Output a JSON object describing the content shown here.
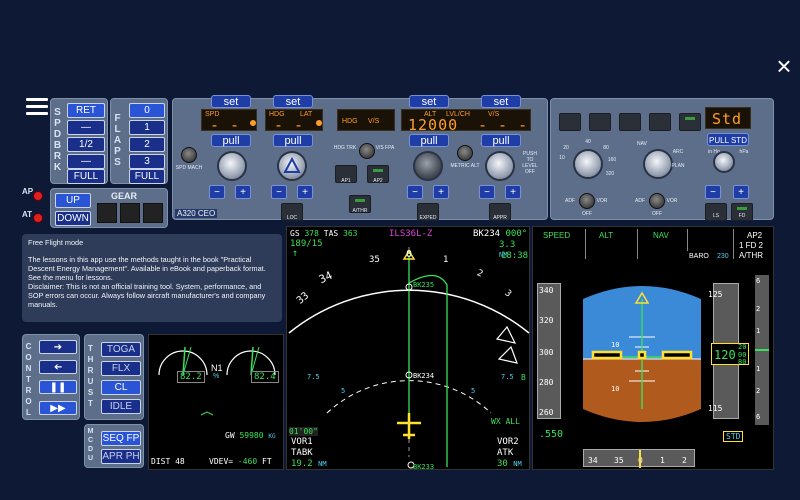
{
  "close_label": "×",
  "speedbrake": {
    "label": "SPD BRK",
    "buttons": [
      "RET",
      "—",
      "1/2",
      "—",
      "FULL"
    ]
  },
  "flaps": {
    "label": "FLAPS",
    "buttons": [
      "0",
      "1",
      "2",
      "3",
      "FULL"
    ]
  },
  "apat": {
    "ap": "AP",
    "at": "AT"
  },
  "gear": {
    "label": "GEAR",
    "up": "UP",
    "down": "DOWN"
  },
  "fcu": {
    "set": "set",
    "pull": "pull",
    "plus": "+",
    "minus": "−",
    "spd": "SPD",
    "mach_lbl": "MACH",
    "spd_mach": "SPD MACH",
    "hdg": "HDG",
    "lat": "LAT",
    "hdg_vs": "HDG",
    "vs": "V/S",
    "alt": "ALT",
    "lvlch": "LVL/CH",
    "vs2": "V/S",
    "spd_val": "- - -",
    "hdg_val": "- - -",
    "alt_val": "12000",
    "vs_val": "- - - -",
    "hdgtrk": "HDG TRK",
    "vsfpa": "V/S FPA",
    "ap1": "AP1",
    "ap2": "AP2",
    "athr": "A/THR",
    "loc": "LOC",
    "expedite": "EXPED",
    "appr": "APPR",
    "metric": "METRIC ALT",
    "model": "A320 CEO",
    "pushlvl": "PUSH TO LEVEL OFF"
  },
  "efis": {
    "baro": "Std",
    "pullstd": "PULL STD",
    "inhg": "in Hg",
    "hpa": "hPa",
    "ls": "LS",
    "fd": "FD",
    "adf": "ADF",
    "vor": "VOR",
    "off": "OFF",
    "arc": "ARC",
    "plan": "PLAN",
    "nav": "NAV",
    "rng": [
      "10",
      "20",
      "40",
      "80",
      "160",
      "320"
    ]
  },
  "info": {
    "title": "Free Flight mode",
    "body": "The lessons in this app use the methods taught in the book \"Practical Descent Energy Management\". Available in eBook and paperback format. See the menu for lessons.",
    "disclaimer": "Disclaimer: This is not an official training tool. System, performance, and SOP errors can occur. Always follow aircraft manufacturer's and company manuals."
  },
  "control": {
    "label": "CONTROL"
  },
  "thrust": {
    "label": "THRUST",
    "buttons": [
      "TOGA",
      "FLX",
      "CL",
      "IDLE"
    ]
  },
  "mcdu": {
    "label": "MCDU",
    "buttons": [
      "SEQ FP",
      "APR PH"
    ]
  },
  "ewd": {
    "n1_left": "82.2",
    "n1_right": "82.4",
    "n1": "N1",
    "pct": "%",
    "gw_label": "GW",
    "gw": "59980",
    "kg": "KG",
    "ft": "FT",
    "dist": "DIST 48",
    "vdev": "VDEV=",
    "vdev_val": "-460"
  },
  "nd": {
    "gs_lbl": "GS",
    "gs": "378",
    "tas_lbl": "TAS",
    "tas": "363",
    "wind": "189/15",
    "approach": "ILS36L-Z",
    "wpt": "BK234",
    "brg": "000°",
    "dist": "3.3",
    "nm": "NM",
    "eta": "18:38",
    "hdg_ticks": [
      "33",
      "34",
      "35",
      "0",
      "1",
      "2",
      "3"
    ],
    "rng1": "7.5",
    "rng2": "5",
    "wpt2": "BK235",
    "wpt3": "BK234",
    "wpt4": "BK233",
    "wx": "WX ALL",
    "time": "01'00\"",
    "vor1": "VOR1",
    "vor1_id": "TABK",
    "vor1_dist": "19.2",
    "vor2": "VOR2",
    "vor2_id": "ATK",
    "vor2_dist": "30",
    "b": "B"
  },
  "pfd": {
    "fma": [
      "SPEED",
      "ALT",
      "NAV",
      "",
      "AP2",
      "1 FD 2",
      "A/THR"
    ],
    "baro": "BARO",
    "baro_val": "230",
    "spd_ticks": [
      "340",
      "320",
      "300",
      "280",
      "260"
    ],
    "mach": ".550",
    "alt_ticks": [
      "125",
      "115"
    ],
    "alt_val": "120",
    "alt_sub": [
      "20",
      "00",
      "80"
    ],
    "std": "STD",
    "hdg_ticks": [
      "34",
      "35",
      "0",
      "1",
      "2"
    ],
    "pitch": [
      "10",
      "10"
    ],
    "vs_ticks": [
      "6",
      "2",
      "1",
      "1",
      "2",
      "6"
    ]
  }
}
